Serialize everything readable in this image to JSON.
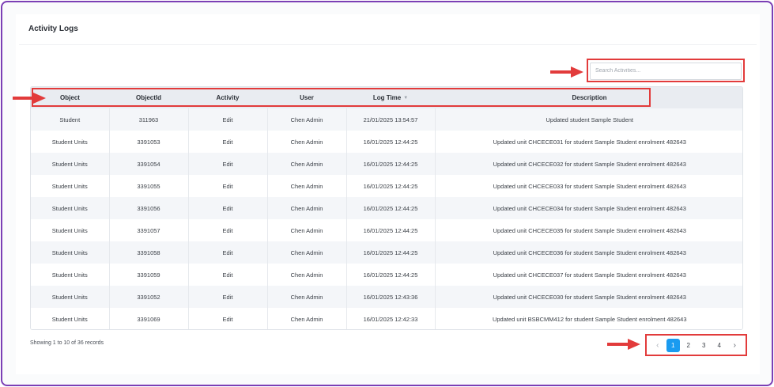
{
  "card": {
    "title": "Activity Logs"
  },
  "search": {
    "placeholder": "Search Activities..."
  },
  "table": {
    "columns": [
      "Object",
      "ObjectId",
      "Activity",
      "User",
      "Log Time",
      "Description"
    ],
    "rows": [
      [
        "Student",
        "311963",
        "Edit",
        "Chen Admin",
        "21/01/2025 13:54:57",
        "Updated student Sample Student"
      ],
      [
        "Student Units",
        "3391053",
        "Edit",
        "Chen Admin",
        "16/01/2025 12:44:25",
        "Updated unit CHCECE031 for student Sample Student enrolment 482643"
      ],
      [
        "Student Units",
        "3391054",
        "Edit",
        "Chen Admin",
        "16/01/2025 12:44:25",
        "Updated unit CHCECE032 for student Sample Student enrolment 482643"
      ],
      [
        "Student Units",
        "3391055",
        "Edit",
        "Chen Admin",
        "16/01/2025 12:44:25",
        "Updated unit CHCECE033 for student Sample Student enrolment 482643"
      ],
      [
        "Student Units",
        "3391056",
        "Edit",
        "Chen Admin",
        "16/01/2025 12:44:25",
        "Updated unit CHCECE034 for student Sample Student enrolment 482643"
      ],
      [
        "Student Units",
        "3391057",
        "Edit",
        "Chen Admin",
        "16/01/2025 12:44:25",
        "Updated unit CHCECE035 for student Sample Student enrolment 482643"
      ],
      [
        "Student Units",
        "3391058",
        "Edit",
        "Chen Admin",
        "16/01/2025 12:44:25",
        "Updated unit CHCECE036 for student Sample Student enrolment 482643"
      ],
      [
        "Student Units",
        "3391059",
        "Edit",
        "Chen Admin",
        "16/01/2025 12:44:25",
        "Updated unit CHCECE037 for student Sample Student enrolment 482643"
      ],
      [
        "Student Units",
        "3391052",
        "Edit",
        "Chen Admin",
        "16/01/2025 12:43:36",
        "Updated unit CHCECE030 for student Sample Student enrolment 482643"
      ],
      [
        "Student Units",
        "3391069",
        "Edit",
        "Chen Admin",
        "16/01/2025 12:42:33",
        "Updated unit BSBCMM412 for student Sample Student enrolment 482643"
      ]
    ]
  },
  "footer": {
    "records_info": "Showing 1 to 10 of 36 records"
  },
  "pagination": {
    "prev": "‹",
    "pages": [
      "1",
      "2",
      "3",
      "4"
    ],
    "active": "1",
    "next": "›"
  },
  "colors": {
    "accent": "#1a9bf0",
    "annotation": "#e23b3b",
    "frame": "#7b3fb5"
  },
  "icons": {
    "sort": "sort-down-icon",
    "annotation_arrow": "red-arrow-icon"
  }
}
